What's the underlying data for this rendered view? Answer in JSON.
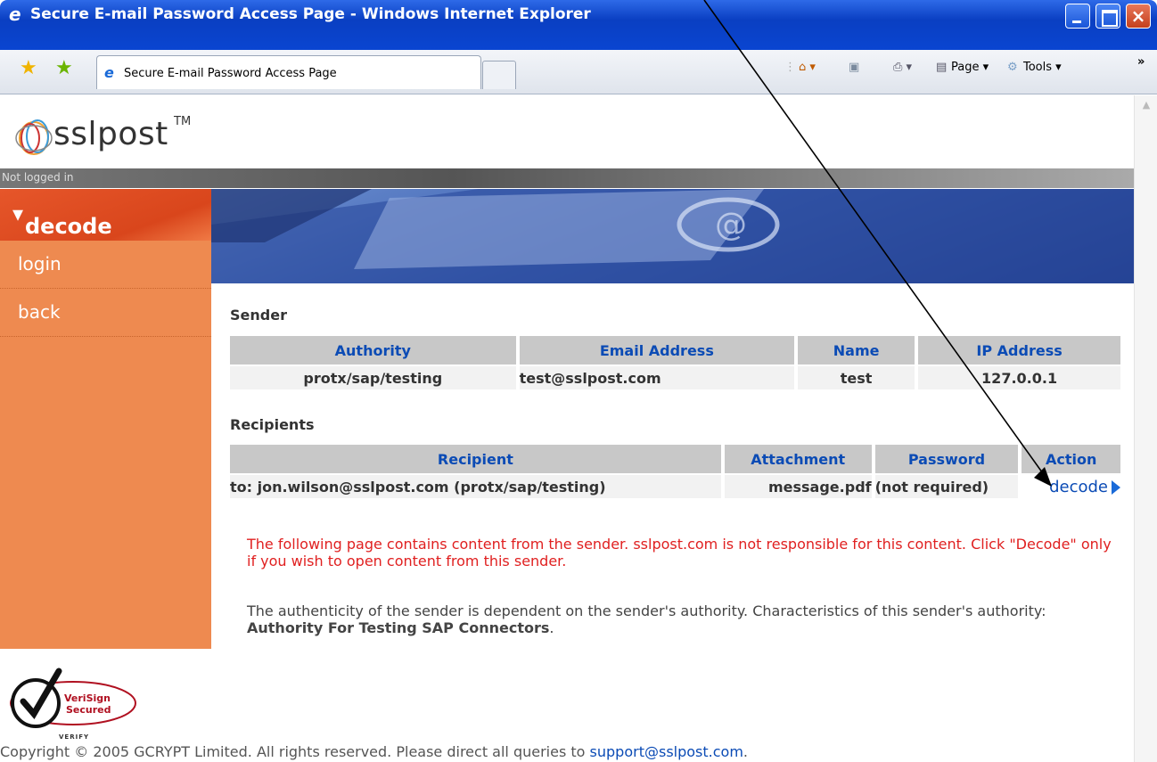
{
  "window": {
    "title": "Secure E-mail Password Access Page - Windows Internet Explorer"
  },
  "tab": {
    "label": "Secure E-mail Password Access Page"
  },
  "command_bar": {
    "page_label": "Page",
    "tools_label": "Tools",
    "overflow": "»"
  },
  "logo": {
    "text": "sslpost",
    "trademark": "TM"
  },
  "status": {
    "login_state": "Not logged in"
  },
  "sidebar": {
    "active": "decode",
    "items": [
      {
        "label": "login"
      },
      {
        "label": "back"
      }
    ]
  },
  "sender": {
    "title": "Sender",
    "headers": [
      "Authority",
      "Email Address",
      "Name",
      "IP Address"
    ],
    "row": {
      "authority": "protx/sap/testing",
      "email": "test@sslpost.com",
      "name": "test",
      "ip": "127.0.0.1"
    }
  },
  "recipients": {
    "title": "Recipients",
    "headers": [
      "Recipient",
      "Attachment",
      "Password",
      "Action"
    ],
    "row": {
      "recipient": "to: jon.wilson@sslpost.com (protx/sap/testing)",
      "attachment": "message.pdf",
      "password": "(not required)",
      "action": "decode"
    }
  },
  "warning": "The following page contains content from the sender. sslpost.com is not responsible for this content. Click \"Decode\" only if you wish to open content from this sender.",
  "authority_note": {
    "prefix": "The authenticity of the sender is dependent on the sender's authority. Characteristics of this sender's authority: ",
    "authority_name": "Authority For Testing SAP Connectors",
    "suffix": "."
  },
  "verisign": {
    "line1": "VeriSign",
    "line2": "Secured",
    "verify": "VERIFY"
  },
  "footer": {
    "text": "Copyright © 2005 GCRYPT Limited. All rights reserved. Please direct all queries to ",
    "email": "support@sslpost.com",
    "suffix": "."
  },
  "colors": {
    "titlebar": "#0a45d1",
    "sidebar": "#ee8a50",
    "active_menu": "#d9461c",
    "link": "#0b4bb5",
    "warning": "#e02020"
  }
}
